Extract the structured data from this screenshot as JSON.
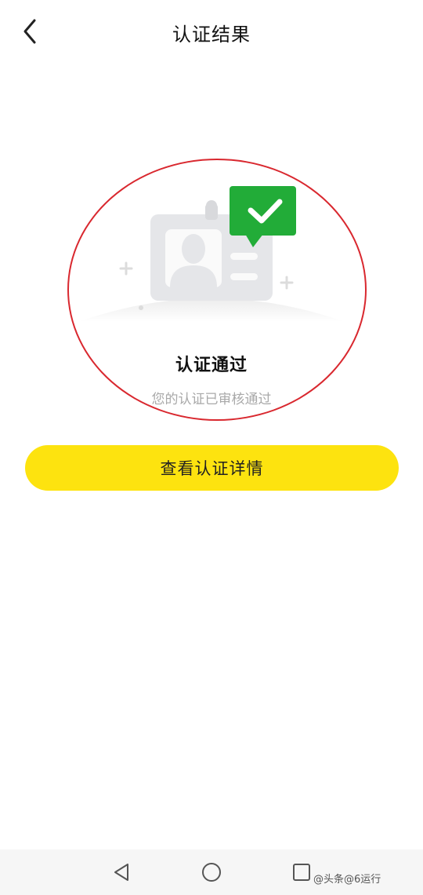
{
  "header": {
    "title": "认证结果",
    "back_icon": "chevron-left-icon"
  },
  "result": {
    "status_title": "认证通过",
    "status_subtitle": "您的认证已审核通过",
    "illustration_icon": "id-card-check-icon",
    "check_color": "#22ac38"
  },
  "actions": {
    "detail_label": "查看认证详情",
    "button_color": "#fde30f"
  },
  "annotation": {
    "ring_color": "#d9282f"
  },
  "system_nav": {
    "back_icon": "triangle-back-icon",
    "home_icon": "circle-home-icon",
    "recent_icon": "square-recent-icon"
  },
  "watermark": {
    "text": "@头条@6运行"
  }
}
